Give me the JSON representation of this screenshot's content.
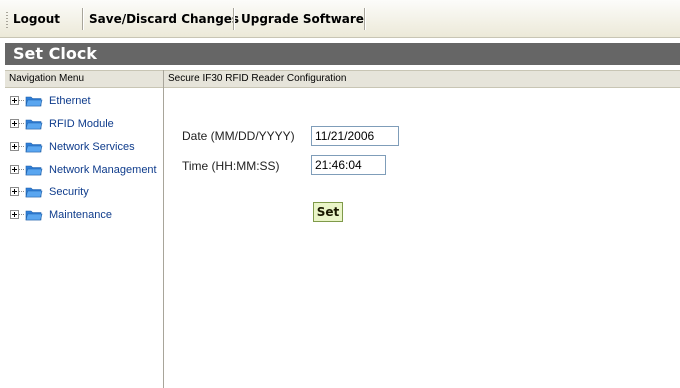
{
  "toolbar": {
    "items": [
      {
        "label": "Logout"
      },
      {
        "label": "Save/Discard Changes"
      },
      {
        "label": "Upgrade Software"
      }
    ]
  },
  "page_title": "Set Clock",
  "nav": {
    "header": "Navigation Menu",
    "items": [
      {
        "label": "Ethernet",
        "icon": "folder-icon"
      },
      {
        "label": "RFID Module",
        "icon": "folder-icon"
      },
      {
        "label": "Network Services",
        "icon": "folder-icon"
      },
      {
        "label": "Network Management",
        "icon": "folder-icon"
      },
      {
        "label": "Security",
        "icon": "folder-icon"
      },
      {
        "label": "Maintenance",
        "icon": "folder-icon"
      }
    ]
  },
  "main": {
    "header": "Secure IF30 RFID Reader Configuration",
    "form": {
      "date_label": "Date (MM/DD/YYYY)",
      "date_value": "11/21/2006",
      "time_label": "Time (HH:MM:SS)",
      "time_value": "21:46:04",
      "submit_label": "Set"
    }
  },
  "colors": {
    "title_bar": "#666666",
    "nav_link": "#0f3c8c",
    "folder": "#3a8ee6",
    "button_bg": "#eaf5c8"
  }
}
